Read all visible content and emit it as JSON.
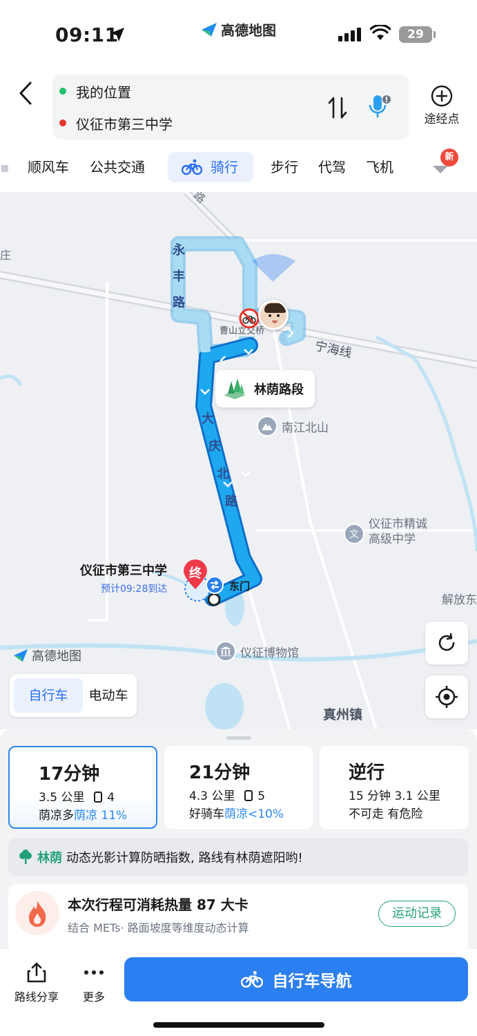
{
  "status_bar": {
    "time": "09:11",
    "app_name": "高德地图",
    "battery": "29"
  },
  "route": {
    "origin": "我的位置",
    "destination": "仪征市第三中学",
    "waypoint_label": "途经点",
    "origin_color": "#1fc16b",
    "destination_color": "#e8352e"
  },
  "mode_tabs": [
    {
      "label": "顺风车"
    },
    {
      "label": "公共交通"
    },
    {
      "label": "骑行",
      "active": true
    },
    {
      "label": "步行"
    },
    {
      "label": "代驾"
    },
    {
      "label": "飞机"
    }
  ],
  "new_badge": "新",
  "map": {
    "labels": {
      "left_edge": "庄",
      "road_top": "路",
      "yongfeng_road": [
        "永",
        "丰",
        "路"
      ],
      "daqing_road": [
        "大",
        "庆",
        "北",
        "路"
      ],
      "caoshan_bridge": "曹山立交桥",
      "ninghai_line": "宁海线",
      "jiefang": "解放东",
      "zhenzhou_town": "真州镇"
    },
    "shade_segment": "林荫路段",
    "pois": {
      "nanjiang": "南江北山",
      "jingcheng": "仪征市精诚\n高级中学",
      "museum": "仪征博物馆",
      "jingcheng_icon": "文"
    },
    "destination": {
      "name": "仪征市第三中学",
      "eta": "预计09:28到达",
      "marker": "终",
      "gate": "东门"
    },
    "logo": "高德地图",
    "bike_types": {
      "selected": "自行车",
      "other": "电动车"
    }
  },
  "plans": [
    {
      "time": "17分钟",
      "dist": "3.5 公里",
      "lights": "4",
      "shade_prefix": "荫凉多",
      "shade_value": "荫凉 11%"
    },
    {
      "time": "21分钟",
      "dist": "4.3 公里",
      "lights": "5",
      "shade_prefix": "好骑车",
      "shade_value": "荫凉<10%"
    },
    {
      "time": "逆行",
      "line1": "15 分钟 3.1 公里",
      "line2": "不可走 有危险"
    }
  ],
  "shade_tip": {
    "tag": "林荫",
    "text": "动态光影计算防晒指数, 路线有林荫遮阳哟!"
  },
  "calorie": {
    "title": "本次行程可消耗热量 87 大卡",
    "subtitle": "结合 METs· 路面坡度等维度动态计算",
    "button": "运动记录"
  },
  "actions": {
    "share": "路线分享",
    "more": "更多",
    "navigate": "自行车导航"
  },
  "colors": {
    "accent": "#2b7ff0",
    "route": "#1a9ef0",
    "shade_green": "#22a07a"
  }
}
